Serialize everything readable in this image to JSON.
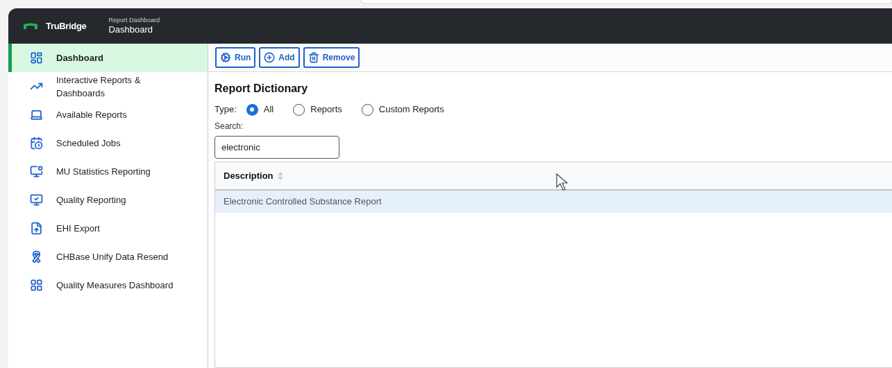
{
  "header": {
    "brand": "TruBridge",
    "breadcrumb": "Report Dashboard",
    "title": "Dashboard"
  },
  "sidebar": {
    "items": [
      {
        "label": "Dashboard",
        "selected": true
      },
      {
        "label": "Interactive Reports & Dashboards",
        "selected": false
      },
      {
        "label": "Available Reports",
        "selected": false
      },
      {
        "label": "Scheduled Jobs",
        "selected": false
      },
      {
        "label": "MU Statistics Reporting",
        "selected": false
      },
      {
        "label": "Quality Reporting",
        "selected": false
      },
      {
        "label": "EHI Export",
        "selected": false
      },
      {
        "label": "CHBase Unify Data Resend",
        "selected": false
      },
      {
        "label": "Quality Measures Dashboard",
        "selected": false
      }
    ]
  },
  "toolbar": [
    {
      "label": "Run"
    },
    {
      "label": "Add"
    },
    {
      "label": "Remove"
    }
  ],
  "section_title": "Report Dictionary",
  "type_filter": {
    "label": "Type:",
    "options": [
      {
        "label": "All",
        "selected": true
      },
      {
        "label": "Reports",
        "selected": false
      },
      {
        "label": "Custom Reports",
        "selected": false
      }
    ]
  },
  "search": {
    "label": "Search:",
    "value": "electronic"
  },
  "table": {
    "columns": [
      "Description"
    ],
    "rows": [
      {
        "cells": [
          "Electronic Controlled Substance Report"
        ],
        "selected": true
      }
    ]
  }
}
